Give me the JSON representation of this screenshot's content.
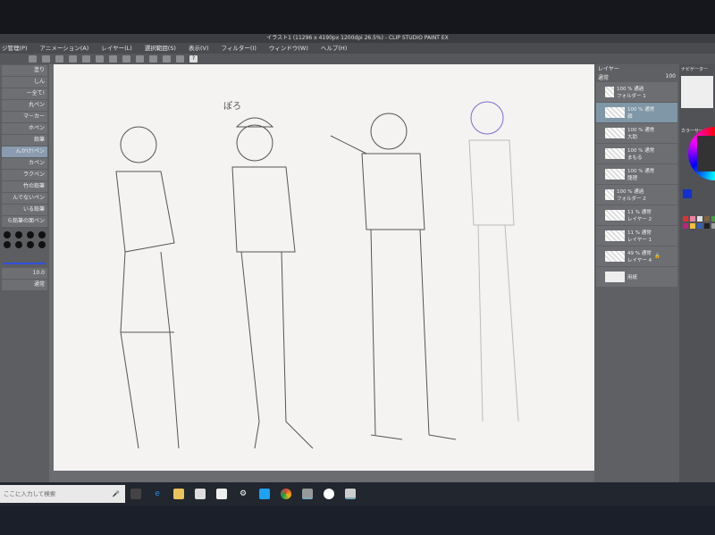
{
  "window": {
    "title": "イラスト1 (11296 x 4190px 1200dpi 26.5%) - CLIP STUDIO PAINT EX"
  },
  "menu": [
    "ジ管理(P)",
    "アニメーション(A)",
    "レイヤー(L)",
    "選択範囲(S)",
    "表示(V)",
    "フィルター(I)",
    "ウィンドウ(W)",
    "ヘルプ(H)"
  ],
  "toolbar": {
    "help": "?"
  },
  "left_panel": {
    "tools": [
      "塗り",
      "しん",
      "ー全て!",
      "丸ペン",
      "マーカー",
      "ホペン",
      "鉛筆",
      "んかけ!ペン",
      "カペン",
      "ラクペン",
      "竹の鉛筆",
      "んでないペン",
      "いる鉛筆",
      "ら鉛筆の面ペン"
    ],
    "brush_size": "10.0",
    "blend_mode": "通常"
  },
  "canvas": {
    "annotation": "ぽろ"
  },
  "layers_panel": {
    "tab": "レイヤー",
    "blend_mode": "通常",
    "opacity": "100",
    "layers": [
      {
        "info": "100 % 通過",
        "name": "フォルダー 1",
        "type": "folder"
      },
      {
        "info": "100 % 通常",
        "name": "顔",
        "selected": true
      },
      {
        "info": "100 % 通常",
        "name": "大助"
      },
      {
        "info": "100 % 通常",
        "name": "まもる"
      },
      {
        "info": "100 % 通常",
        "name": "龍理"
      },
      {
        "info": "100 % 通過",
        "name": "フォルダー 2",
        "type": "folder"
      },
      {
        "info": "11 % 通常",
        "name": "レイヤー 2"
      },
      {
        "info": "11 % 通常",
        "name": "レイヤー 1"
      },
      {
        "info": "49 % 通常",
        "name": "レイヤー 4"
      },
      {
        "info": "",
        "name": "用紙"
      }
    ]
  },
  "right_panel": {
    "tab": "ナビゲーター",
    "color_tab": "カラーサークル",
    "primary_color": "#1030d0"
  },
  "taskbar": {
    "search_placeholder": "ここに入力して検索",
    "apps": [
      "task-view",
      "edge",
      "explorer",
      "store",
      "mail",
      "settings",
      "twitter",
      "chrome",
      "app1",
      "app2",
      "clip-studio"
    ]
  }
}
